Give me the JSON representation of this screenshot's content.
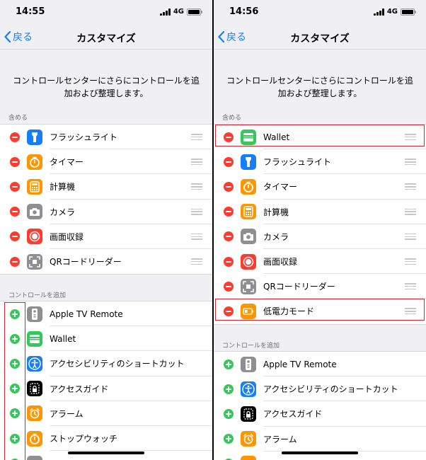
{
  "colors": {
    "accent": "#147efb",
    "remove": "#ff3b30",
    "add": "#34c759",
    "highlight": "#e02030",
    "background": "#efeff4"
  },
  "screens": [
    {
      "status": {
        "time": "14:55",
        "network": "4G"
      },
      "nav": {
        "back_label": "戻る",
        "title": "カスタマイズ"
      },
      "description": "コントロールセンターにさらにコントロールを追加および整理します。",
      "included_header": "含める",
      "included": [
        {
          "label": "フラッシュライト",
          "icon": "flashlight-icon",
          "color": "#147efb"
        },
        {
          "label": "タイマー",
          "icon": "timer-icon",
          "color": "#ff9500"
        },
        {
          "label": "計算機",
          "icon": "calculator-icon",
          "color": "#ff9500"
        },
        {
          "label": "カメラ",
          "icon": "camera-icon",
          "color": "#8e8e93"
        },
        {
          "label": "画面収録",
          "icon": "screen-recording-icon",
          "color": "#ff3b30"
        },
        {
          "label": "QRコードリーダー",
          "icon": "qr-code-icon",
          "color": "#8e8e93"
        }
      ],
      "more_header": "コントロールを追加",
      "more": [
        {
          "label": "Apple TV Remote",
          "icon": "apple-tv-remote-icon",
          "color": "#8e8e93"
        },
        {
          "label": "Wallet",
          "icon": "wallet-icon",
          "color": "#34c759"
        },
        {
          "label": "アクセシビリティのショートカット",
          "icon": "accessibility-icon",
          "color": "#147efb"
        },
        {
          "label": "アクセスガイド",
          "icon": "guided-access-icon",
          "color": "#000000"
        },
        {
          "label": "アラーム",
          "icon": "alarm-icon",
          "color": "#ff9500"
        },
        {
          "label": "ストップウォッチ",
          "icon": "stopwatch-icon",
          "color": "#ff9500"
        },
        {
          "label": "",
          "icon": "partial-icon",
          "color": "#8e8e93"
        }
      ]
    },
    {
      "status": {
        "time": "14:56",
        "network": "4G"
      },
      "nav": {
        "back_label": "戻る",
        "title": "カスタマイズ"
      },
      "description": "コントロールセンターにさらにコントロールを追加および整理します。",
      "included_header": "含める",
      "included": [
        {
          "label": "Wallet",
          "icon": "wallet-icon",
          "color": "#34c759"
        },
        {
          "label": "フラッシュライト",
          "icon": "flashlight-icon",
          "color": "#147efb"
        },
        {
          "label": "タイマー",
          "icon": "timer-icon",
          "color": "#ff9500"
        },
        {
          "label": "計算機",
          "icon": "calculator-icon",
          "color": "#ff9500"
        },
        {
          "label": "カメラ",
          "icon": "camera-icon",
          "color": "#8e8e93"
        },
        {
          "label": "画面収録",
          "icon": "screen-recording-icon",
          "color": "#ff3b30"
        },
        {
          "label": "QRコードリーダー",
          "icon": "qr-code-icon",
          "color": "#8e8e93"
        },
        {
          "label": "低電力モード",
          "icon": "low-power-mode-icon",
          "color": "#ff9500"
        }
      ],
      "more_header": "コントロールを追加",
      "more": [
        {
          "label": "Apple TV Remote",
          "icon": "apple-tv-remote-icon",
          "color": "#8e8e93"
        },
        {
          "label": "アクセシビリティのショートカット",
          "icon": "accessibility-icon",
          "color": "#147efb"
        },
        {
          "label": "アクセスガイド",
          "icon": "guided-access-icon",
          "color": "#000000"
        },
        {
          "label": "アラーム",
          "icon": "alarm-icon",
          "color": "#ff9500"
        },
        {
          "label": "",
          "icon": "partial-icon",
          "color": "#ff9500"
        }
      ]
    }
  ]
}
